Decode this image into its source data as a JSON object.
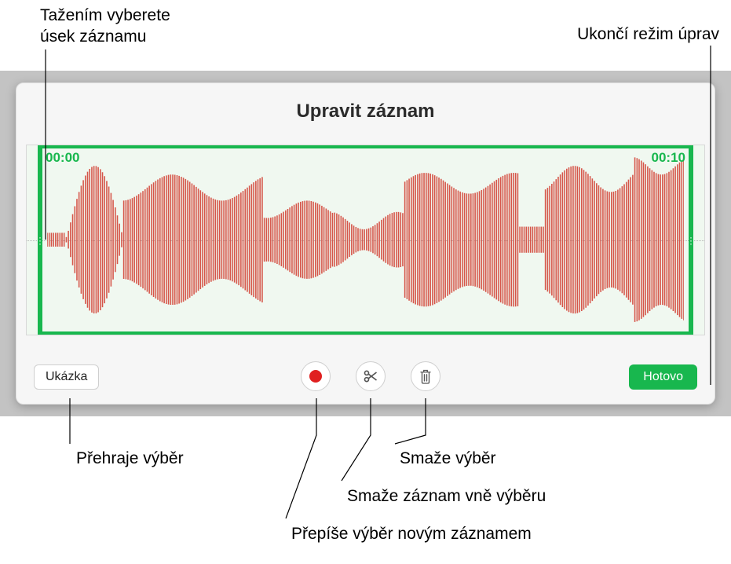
{
  "callouts": {
    "drag_select": "Tažením vyberete\núsek záznamu",
    "exit_edit": "Ukončí režim úprav",
    "play_selection": "Přehraje výběr",
    "delete_selection": "Smaže výběr",
    "delete_outside": "Smaže záznam vně výběru",
    "overwrite": "Přepíše výběr novým záznamem"
  },
  "panel": {
    "title": "Upravit záznam",
    "time_start": "00:00",
    "time_end": "00:10"
  },
  "buttons": {
    "preview": "Ukázka",
    "done": "Hotovo"
  }
}
